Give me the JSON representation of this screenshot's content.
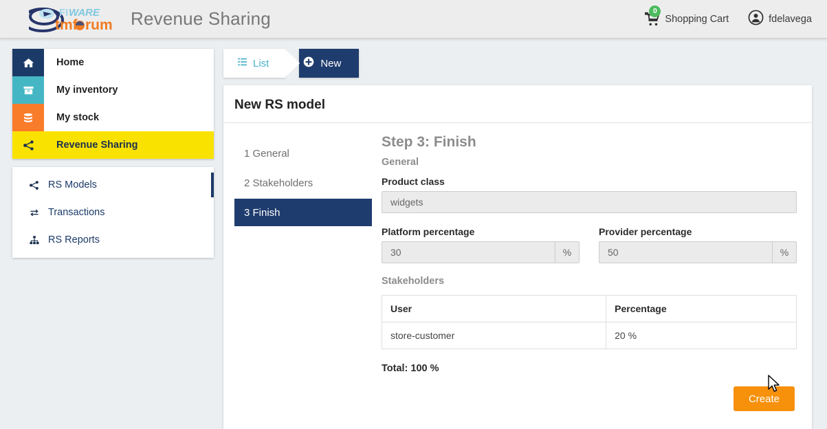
{
  "header": {
    "app_title": "Revenue Sharing",
    "logo_primary": "FIWARE",
    "logo_secondary": "tmforum",
    "cart_label": "Shopping Cart",
    "cart_count": "0",
    "user_name": "fdelavega",
    "cart_icon": "shopping-cart-icon",
    "user_icon": "user-circle-icon"
  },
  "sidebar": {
    "items": [
      {
        "label": "Home",
        "icon": "home-icon",
        "color": "#1b3a68",
        "active": false
      },
      {
        "label": "My inventory",
        "icon": "inventory-box-icon",
        "color": "#45b7c4",
        "active": false
      },
      {
        "label": "My stock",
        "icon": "database-stack-icon",
        "color": "#f97c2b",
        "active": false
      },
      {
        "label": "Revenue Sharing",
        "icon": "share-nodes-icon",
        "color": "#fae200",
        "active": true
      }
    ],
    "submenu": [
      {
        "label": "RS Models",
        "icon": "share-nodes-icon",
        "active": true
      },
      {
        "label": "Transactions",
        "icon": "exchange-arrows-icon",
        "active": false
      },
      {
        "label": "RS Reports",
        "icon": "sitemap-icon",
        "active": false
      }
    ]
  },
  "tabs": [
    {
      "label": "List",
      "icon": "list-icon",
      "active": false
    },
    {
      "label": "New",
      "icon": "plus-circle-icon",
      "active": true
    }
  ],
  "panel": {
    "title": "New RS model",
    "steps": [
      {
        "label": "1 General",
        "active": false
      },
      {
        "label": "2 Stakeholders",
        "active": false
      },
      {
        "label": "3 Finish",
        "active": true
      }
    ],
    "step_heading": "Step 3: Finish",
    "general_heading": "General",
    "product_class_label": "Product class",
    "product_class_value": "widgets",
    "platform_label": "Platform percentage",
    "platform_value": "30",
    "platform_unit": "%",
    "provider_label": "Provider percentage",
    "provider_value": "50",
    "provider_unit": "%",
    "stakeholders_heading": "Stakeholders",
    "table": {
      "columns": [
        "User",
        "Percentage"
      ],
      "rows": [
        [
          "store-customer",
          "20 %"
        ]
      ]
    },
    "total_label": "Total: 100 %",
    "create_label": "Create"
  },
  "colors": {
    "page_bg": "#eceff1",
    "header_bg": "#ededed",
    "navy": "#1f3c6e",
    "teal": "#4ab3c8",
    "orange_btn": "#f7900a",
    "yellow": "#fae200",
    "badge_green": "#4cbb5f"
  }
}
